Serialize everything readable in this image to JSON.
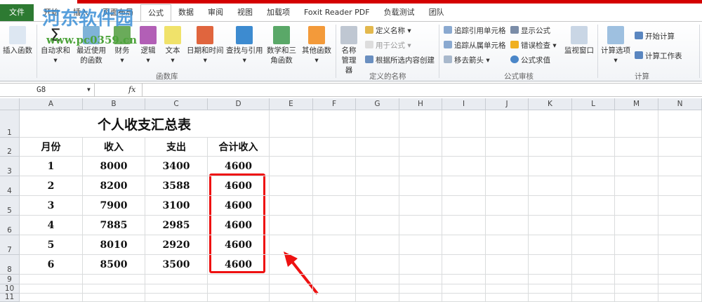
{
  "tabs": [
    "文件",
    "开始",
    "插入",
    "页面布局",
    "公式",
    "数据",
    "审阅",
    "视图",
    "加载项",
    "Foxit Reader PDF",
    "负载测试",
    "团队"
  ],
  "active_tab": "公式",
  "watermark": {
    "name": "河东软件园",
    "url": "www.pc0359.cn"
  },
  "ribbon": {
    "function_library": {
      "label": "函数库",
      "buttons": [
        "插入函数",
        "自动求和",
        "最近使用的函数",
        "财务",
        "逻辑",
        "文本",
        "日期和时间",
        "查找与引用",
        "数学和三角函数",
        "其他函数"
      ]
    },
    "defined_names": {
      "label": "定义的名称",
      "manager": "名称管理器",
      "items": [
        "定义名称",
        "用于公式",
        "根据所选内容创建"
      ]
    },
    "formula_auditing": {
      "label": "公式审核",
      "items": [
        "追踪引用单元格",
        "追踪从属单元格",
        "移去箭头",
        "显示公式",
        "错误检查",
        "公式求值"
      ],
      "watch": "监视窗口"
    },
    "calculation": {
      "label": "计算",
      "options": "计算选项",
      "items": [
        "开始计算",
        "计算工作表"
      ]
    }
  },
  "formula_bar": {
    "name_box": "G8",
    "fx": "fx",
    "value": ""
  },
  "columns": [
    "A",
    "B",
    "C",
    "D",
    "E",
    "F",
    "G",
    "H",
    "I",
    "J",
    "K",
    "L",
    "M",
    "N"
  ],
  "rows": [
    "1",
    "2",
    "3",
    "4",
    "5",
    "6",
    "7",
    "8",
    "9",
    "10",
    "11"
  ],
  "sheet": {
    "title": "个人收支汇总表",
    "headers": [
      "月份",
      "收入",
      "支出",
      "合计收入"
    ],
    "data": [
      [
        "1",
        "8000",
        "3400",
        "4600"
      ],
      [
        "2",
        "8200",
        "3588",
        "4600"
      ],
      [
        "3",
        "7900",
        "3100",
        "4600"
      ],
      [
        "4",
        "7885",
        "2985",
        "4600"
      ],
      [
        "5",
        "8010",
        "2920",
        "4600"
      ],
      [
        "6",
        "8500",
        "3500",
        "4600"
      ]
    ]
  },
  "colors": {
    "highlight": "#e11111",
    "file_tab": "#2d7a32"
  }
}
